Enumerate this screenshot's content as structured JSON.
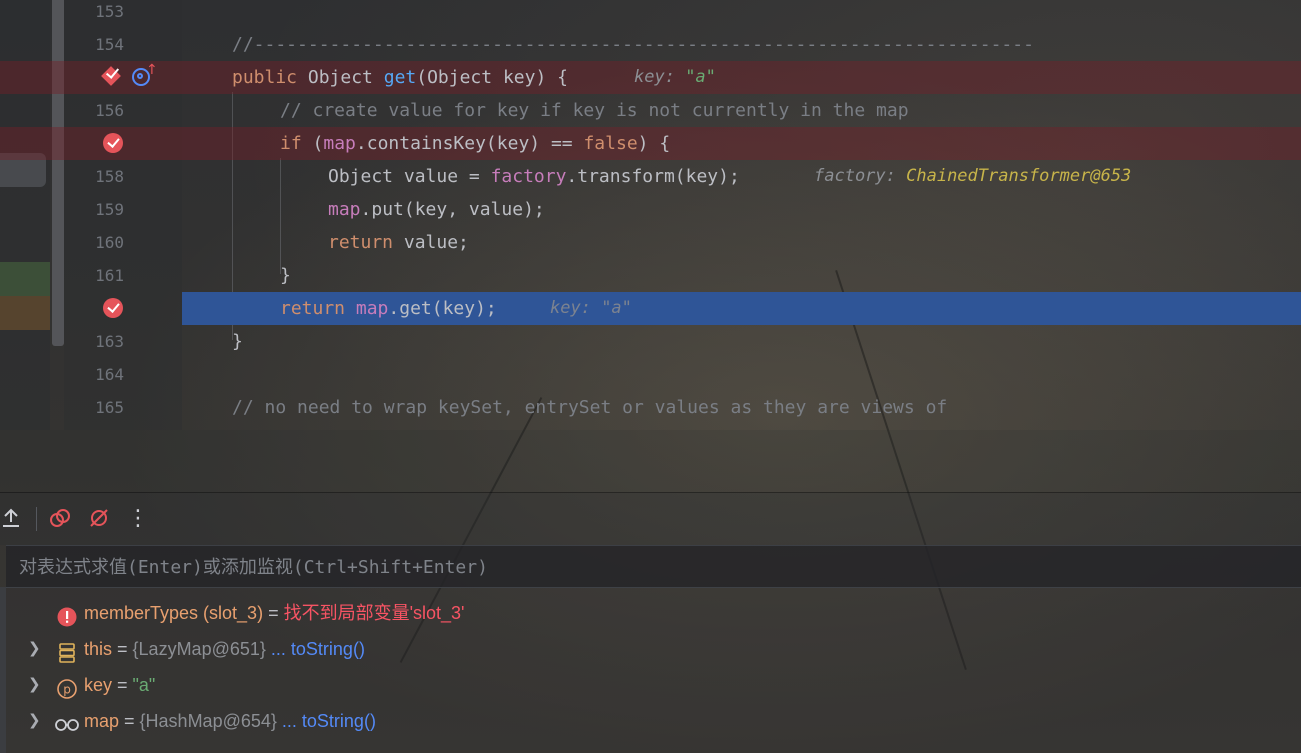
{
  "editor": {
    "lines": [
      {
        "num": "153",
        "text": ""
      },
      {
        "num": "154",
        "text": "//------------------------------------------------------------------------"
      },
      {
        "num": "",
        "kw": "public",
        "t1": " Object ",
        "fn": "get",
        "t2": "(Object key) {",
        "hint_label": "key: ",
        "hint_value": "\"a\""
      },
      {
        "num": "156",
        "text": "// create value for key if key is not currently in the map"
      },
      {
        "num": "",
        "kw": "if",
        "t1": " (",
        "fld": "map",
        "t2": ".containsKey(key) == ",
        "kw2": "false",
        "t3": ") {"
      },
      {
        "num": "158",
        "t1": "Object value = ",
        "fld": "factory",
        "t2": ".transform(key);",
        "hint_label": "factory: ",
        "hint_value": "ChainedTransformer@653"
      },
      {
        "num": "159",
        "fld": "map",
        "t2": ".put(key, value);"
      },
      {
        "num": "160",
        "kw": "return",
        "t2": " value;"
      },
      {
        "num": "161",
        "text": "}"
      },
      {
        "num": "",
        "kw": "return",
        "t1": " ",
        "fld": "map",
        "t2": ".get(key);",
        "hint_label": "key: ",
        "hint_value": "\"a\""
      },
      {
        "num": "163",
        "text": "}"
      },
      {
        "num": "164",
        "text": ""
      },
      {
        "num": "165",
        "text": "// no need to wrap keySet, entrySet or values as they are views of"
      }
    ]
  },
  "toolbar": {
    "icons": [
      "upload-icon",
      "mute-breakpoints-icon",
      "disable-breakpoints-icon",
      "more-icon"
    ],
    "more_label": "⋮"
  },
  "evaluate": {
    "placeholder": "对表达式求值(Enter)或添加监视(Ctrl+Shift+Enter)"
  },
  "variables": [
    {
      "name": "memberTypes (slot_3)",
      "eq": " = ",
      "value": "找不到局部变量'slot_3'",
      "icon": "error-icon"
    },
    {
      "name": "this",
      "eq": " = ",
      "type": "{LazyMap@651}",
      "link": " ... toString()",
      "icon": "field-stack-icon"
    },
    {
      "name": "key",
      "eq": " = ",
      "value": "\"a\"",
      "icon": "parameter-icon"
    },
    {
      "name": "map",
      "eq": " = ",
      "type": "{HashMap@654}",
      "link": " ... toString()",
      "icon": "watch-glasses-icon"
    }
  ],
  "colors": {
    "breakpoint": "#e5545a",
    "current_line": "#2f5597",
    "keyword": "#cf8e6d",
    "function": "#56a8f5",
    "field": "#c77dbb",
    "string": "#6aab73",
    "link": "#548af7"
  }
}
